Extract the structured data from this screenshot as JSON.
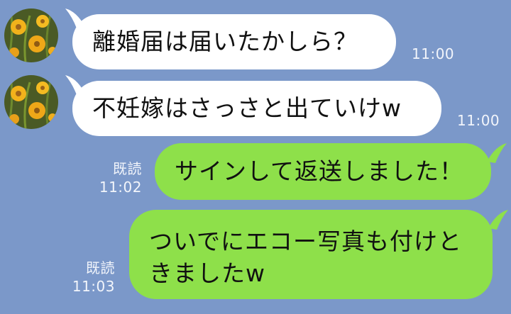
{
  "messages": [
    {
      "side": "incoming",
      "text": "離婚届は届いたかしら？",
      "time": "11:00"
    },
    {
      "side": "incoming",
      "text": "不妊嫁はさっさと出ていけw",
      "time": "11:00"
    },
    {
      "side": "outgoing",
      "text": "サインして返送しました！",
      "read": "既読",
      "time": "11:02"
    },
    {
      "side": "outgoing",
      "text_line1": "ついでにエコー写真も付けと",
      "text_line2": "きましたw",
      "read": "既読",
      "time": "11:03"
    }
  ],
  "colors": {
    "background": "#7b98c9",
    "incoming_bubble": "#ffffff",
    "outgoing_bubble": "#8ee04a",
    "meta_text": "#f2f5fb"
  },
  "icons": {
    "avatar": "yellow-flowers-photo"
  }
}
